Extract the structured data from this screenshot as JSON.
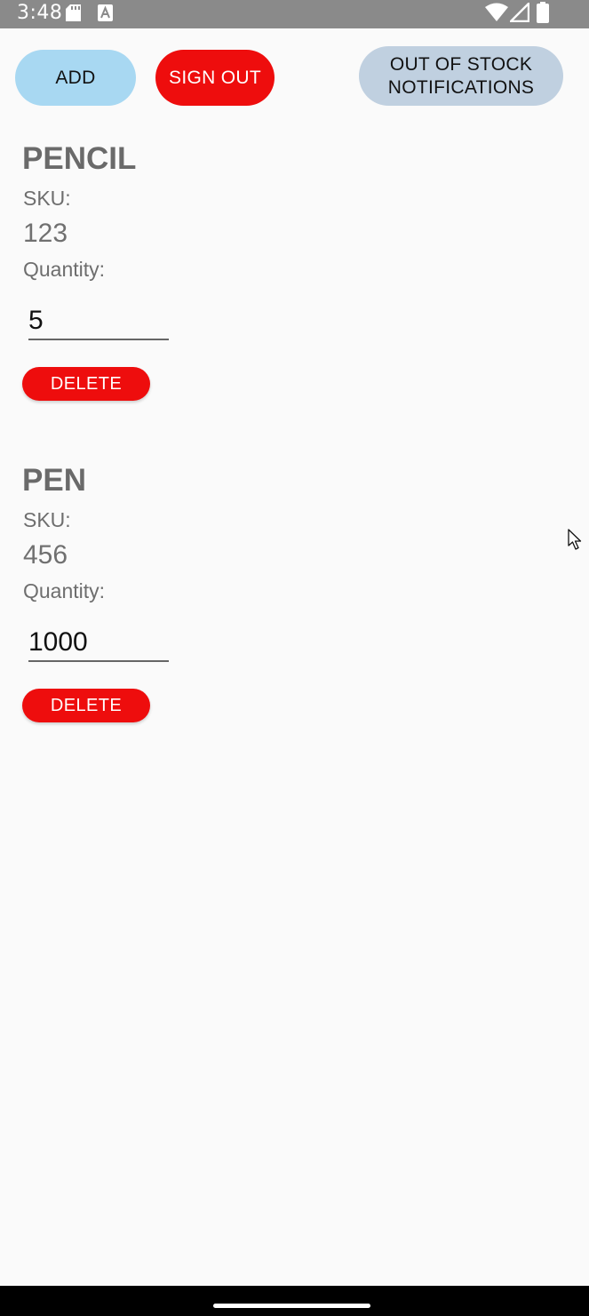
{
  "status_bar": {
    "time": "3:48",
    "icons": [
      "sd-card-icon",
      "app-notification-icon",
      "wifi-icon",
      "signal-icon",
      "battery-icon"
    ]
  },
  "toolbar": {
    "add_label": "ADD",
    "sign_out_label": "SIGN OUT",
    "out_of_stock_label": "OUT OF STOCK\nNOTIFICATIONS"
  },
  "products": [
    {
      "name": "PENCIL",
      "sku_label": "SKU:",
      "sku": "123",
      "quantity_label": "Quantity:",
      "quantity": "5",
      "delete_label": "DELETE"
    },
    {
      "name": "PEN",
      "sku_label": "SKU:",
      "sku": "456",
      "quantity_label": "Quantity:",
      "quantity": "1000",
      "delete_label": "DELETE"
    }
  ],
  "colors": {
    "add_button": "#a8d8f2",
    "danger": "#ee0d0d",
    "out_of_stock_button": "#c0d0e0",
    "background": "#fafafa",
    "status_bar": "#8a8a8a"
  }
}
